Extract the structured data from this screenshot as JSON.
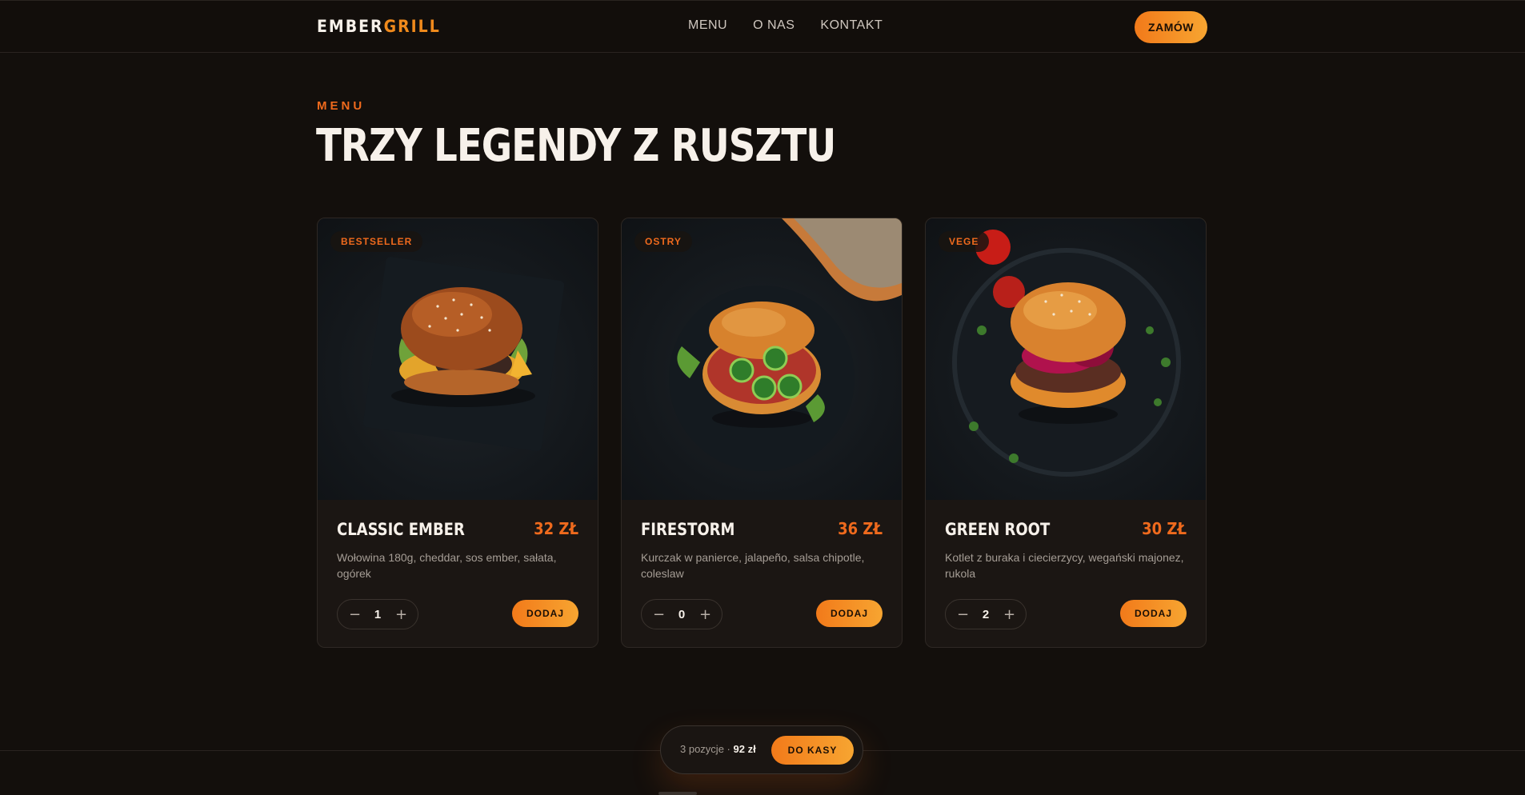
{
  "header": {
    "logo_part1": "EMBER",
    "logo_part2": "GRILL",
    "nav": [
      "MENU",
      "O NAS",
      "KONTAKT"
    ],
    "order_label": "ZAMÓW"
  },
  "hero": {
    "eyebrow": "MENU",
    "title": "TRZY LEGENDY Z RUSZTU"
  },
  "products": [
    {
      "badge": "BESTSELLER",
      "name": "CLASSIC EMBER",
      "price": "32 ZŁ",
      "description": "Wołowina 180g, cheddar, sos ember, sałata, ogórek",
      "quantity": "1",
      "add_label": "DODAJ"
    },
    {
      "badge": "OSTRY",
      "name": "FIRESTORM",
      "price": "36 ZŁ",
      "description": "Kurczak w panierce, jalapeño, salsa chipotle, coleslaw",
      "quantity": "0",
      "add_label": "DODAJ"
    },
    {
      "badge": "VEGE",
      "name": "GREEN ROOT",
      "price": "30 ZŁ",
      "description": "Kotlet z buraka i ciecierzycy, wegański majonez, rukola",
      "quantity": "2",
      "add_label": "DODAJ"
    }
  ],
  "cart": {
    "count_text": "3 pozycje ·",
    "total": "92 zł",
    "checkout_label": "DO KASY"
  },
  "stepper_icons": {
    "minus": "minus-icon",
    "plus": "plus-icon"
  },
  "colors": {
    "accent": "#ef6a1d",
    "accent_gradient_end": "#f7a531",
    "background": "#130f0c",
    "card": "#1b1613"
  }
}
